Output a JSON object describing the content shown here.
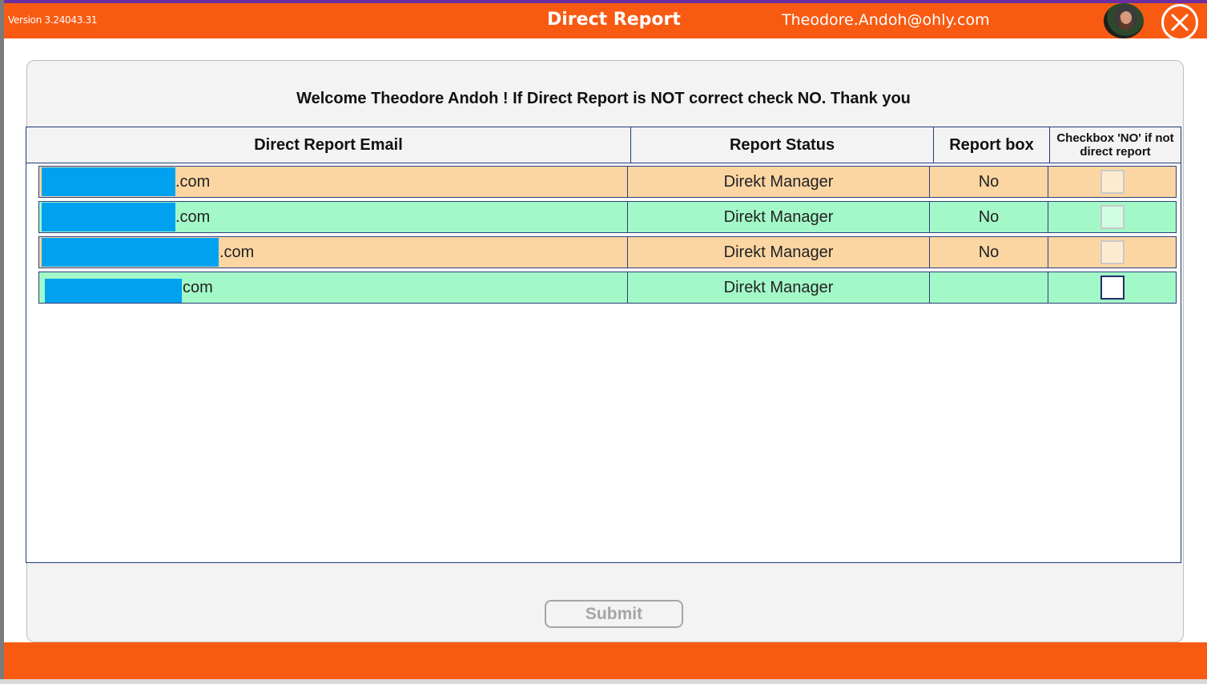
{
  "header": {
    "version": "Version 3.24043.31",
    "title": "Direct Report",
    "user_email": "Theodore.Andoh@ohly.com"
  },
  "welcome_text": "Welcome Theodore Andoh ! If Direct Report is NOT correct check NO. Thank you",
  "table": {
    "columns": [
      "Direct Report Email",
      "Report Status",
      "Report box",
      "Checkbox 'NO' if not direct report"
    ],
    "rows": [
      {
        "email_suffix": ".com",
        "status": "Direkt Manager",
        "report_box": "No",
        "checked": false
      },
      {
        "email_suffix": ".com",
        "status": "Direkt Manager",
        "report_box": "No",
        "checked": false
      },
      {
        "email_suffix": ".com",
        "status": "Direkt Manager",
        "report_box": "No",
        "checked": false
      },
      {
        "email_suffix": "com",
        "status": "Direkt Manager",
        "report_box": "",
        "checked": false
      }
    ]
  },
  "footer": {
    "submit_label": "Submit"
  },
  "colors": {
    "brand_orange": "#f85a12",
    "row_orange": "#fbd6a3",
    "row_green": "#a3f8c8",
    "redaction_blue": "#00a2f0",
    "table_border": "#1f3a7a"
  }
}
